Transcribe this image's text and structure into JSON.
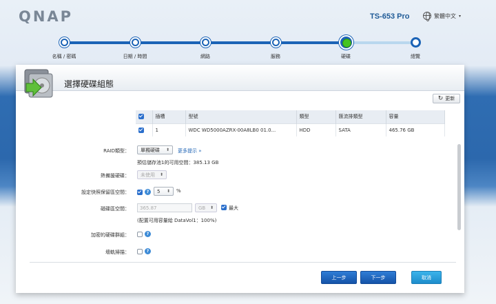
{
  "brand": {
    "logo": "QNAP",
    "model": "TS-653 Pro",
    "language": "繁體中文"
  },
  "steps": [
    {
      "label": "名稱 / 密碼",
      "state": "done"
    },
    {
      "label": "日期 / 時間",
      "state": "done"
    },
    {
      "label": "網路",
      "state": "done"
    },
    {
      "label": "服務",
      "state": "done"
    },
    {
      "label": "硬碟",
      "state": "current"
    },
    {
      "label": "總覽",
      "state": "pending"
    }
  ],
  "dialog": {
    "title": "選擇硬碟組態",
    "refresh_label": "更新",
    "table": {
      "headers": [
        "插槽",
        "型號",
        "類型",
        "匯流排類型",
        "容量"
      ],
      "rows": [
        {
          "slot": "1",
          "model": "WDC WD5000AZRX-00A8LB0 01.0...",
          "type": "HDD",
          "bus": "SATA",
          "capacity": "465.76 GB"
        }
      ]
    },
    "raid": {
      "label": "RAID類型：",
      "value": "單獨硬碟",
      "more_link": "更多提示 »",
      "estimate": "預估儲存池1的可用空間：385.13 GB"
    },
    "hot_spare": {
      "label": "熱備援硬碟：",
      "value": "未使用"
    },
    "snapshot": {
      "label": "設定快照保留區空間：",
      "value": "5",
      "unit": "%"
    },
    "disk_space": {
      "label": "磁碟區空間：",
      "value": "365.87",
      "unit": "GB",
      "max_label": "最大",
      "note": "(配置可用容量給 DataVol1：100%)"
    },
    "encrypt": {
      "label": "加密的硬碟群組："
    },
    "bad_block": {
      "label": "壞軌掃描："
    },
    "buttons": {
      "back": "上一步",
      "next": "下一步",
      "cancel": "取消"
    }
  }
}
